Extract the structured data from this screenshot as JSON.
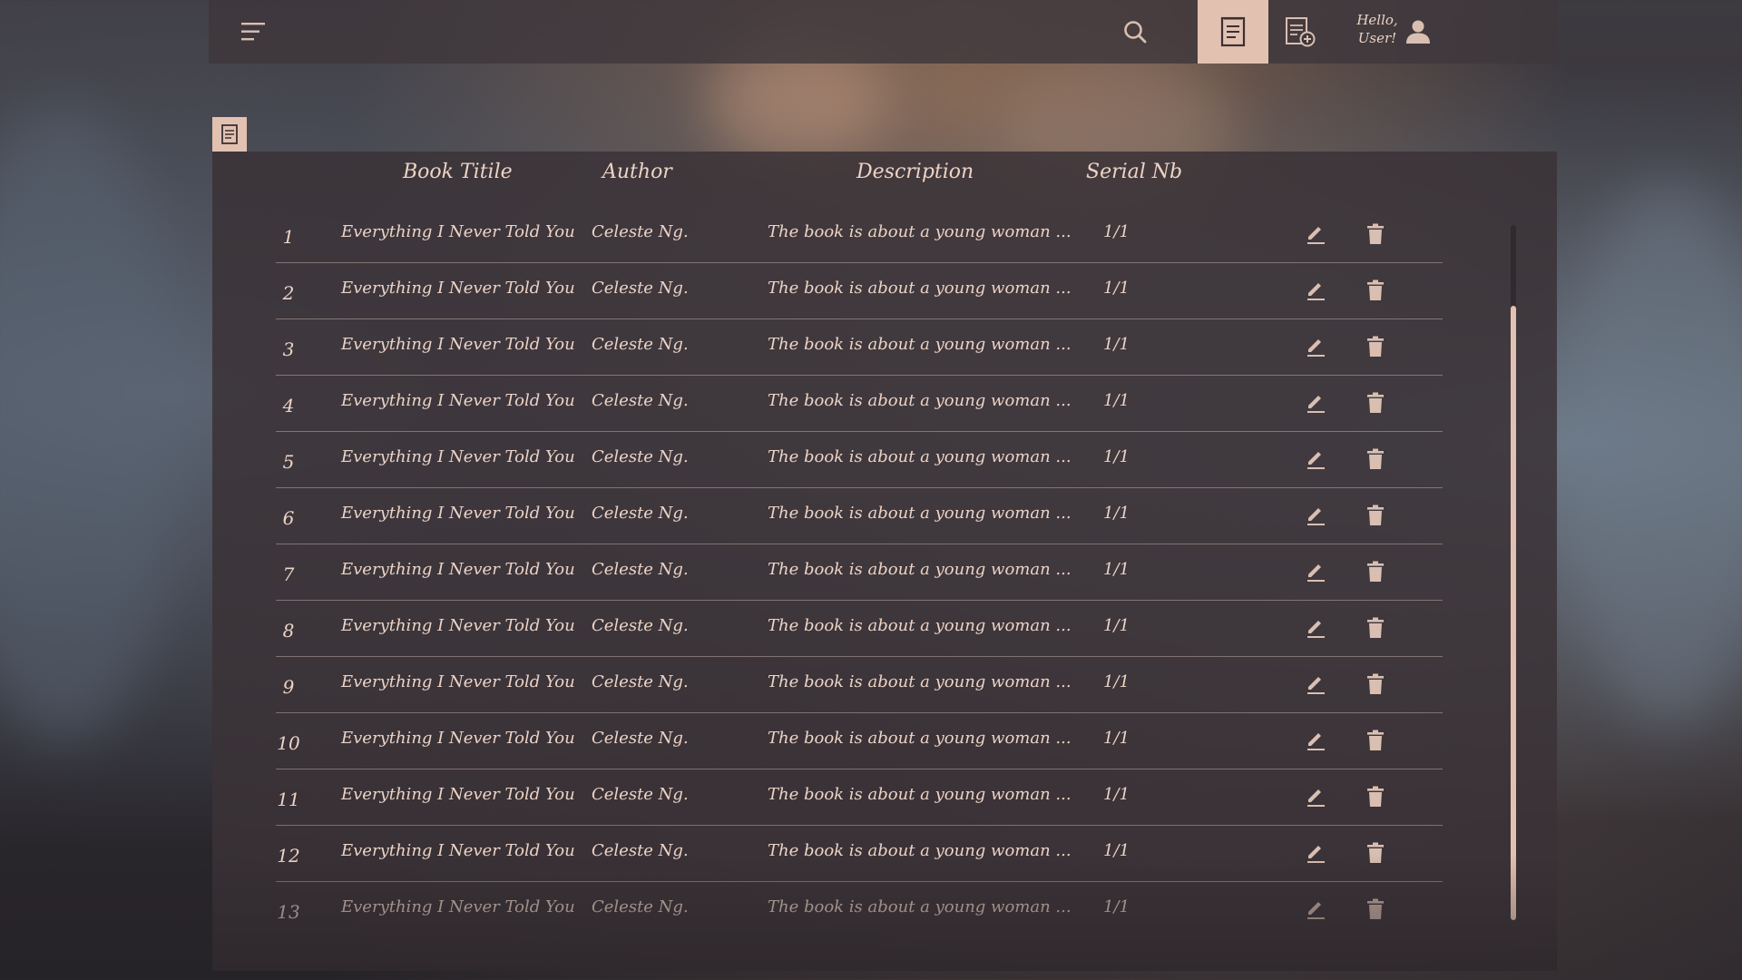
{
  "header": {
    "greeting_line1": "Hello,",
    "greeting_line2": "User!",
    "icons": [
      "menu-icon",
      "search-icon",
      "books-list-icon",
      "add-book-icon",
      "user-icon"
    ],
    "accent_color": "#e3c1b1"
  },
  "table": {
    "panel_icon": "books-list-icon",
    "columns": {
      "title": "Book Titile",
      "author": "Author",
      "description": "Description",
      "serial": "Serial Nb"
    },
    "rows": [
      {
        "num": "1",
        "title": "Everything I Never Told You",
        "author": "Celeste Ng.",
        "description": "The book is about a young woman ...",
        "serial": "1/1"
      },
      {
        "num": "2",
        "title": "Everything I Never Told You",
        "author": "Celeste Ng.",
        "description": "The book is about a young woman ...",
        "serial": "1/1"
      },
      {
        "num": "3",
        "title": "Everything I Never Told You",
        "author": "Celeste Ng.",
        "description": "The book is about a young woman ...",
        "serial": "1/1"
      },
      {
        "num": "4",
        "title": "Everything I Never Told You",
        "author": "Celeste Ng.",
        "description": "The book is about a young woman ...",
        "serial": "1/1"
      },
      {
        "num": "5",
        "title": "Everything I Never Told You",
        "author": "Celeste Ng.",
        "description": "The book is about a young woman ...",
        "serial": "1/1"
      },
      {
        "num": "6",
        "title": "Everything I Never Told You",
        "author": "Celeste Ng.",
        "description": "The book is about a young woman ...",
        "serial": "1/1"
      },
      {
        "num": "7",
        "title": "Everything I Never Told You",
        "author": "Celeste Ng.",
        "description": "The book is about a young woman ...",
        "serial": "1/1"
      },
      {
        "num": "8",
        "title": "Everything I Never Told You",
        "author": "Celeste Ng.",
        "description": "The book is about a young woman ...",
        "serial": "1/1"
      },
      {
        "num": "9",
        "title": "Everything I Never Told You",
        "author": "Celeste Ng.",
        "description": "The book is about a young woman ...",
        "serial": "1/1"
      },
      {
        "num": "10",
        "title": "Everything I Never Told You",
        "author": "Celeste Ng.",
        "description": "The book is about a young woman ...",
        "serial": "1/1"
      },
      {
        "num": "11",
        "title": "Everything I Never Told You",
        "author": "Celeste Ng.",
        "description": "The book is about a young woman ...",
        "serial": "1/1"
      },
      {
        "num": "12",
        "title": "Everything I Never Told You",
        "author": "Celeste Ng.",
        "description": "The book is about a young woman ...",
        "serial": "1/1"
      },
      {
        "num": "13",
        "title": "Everything I Never Told You",
        "author": "Celeste Ng.",
        "description": "The book is about a young woman ...",
        "serial": "1/1"
      }
    ],
    "row_actions": [
      "edit-icon",
      "delete-icon"
    ]
  }
}
